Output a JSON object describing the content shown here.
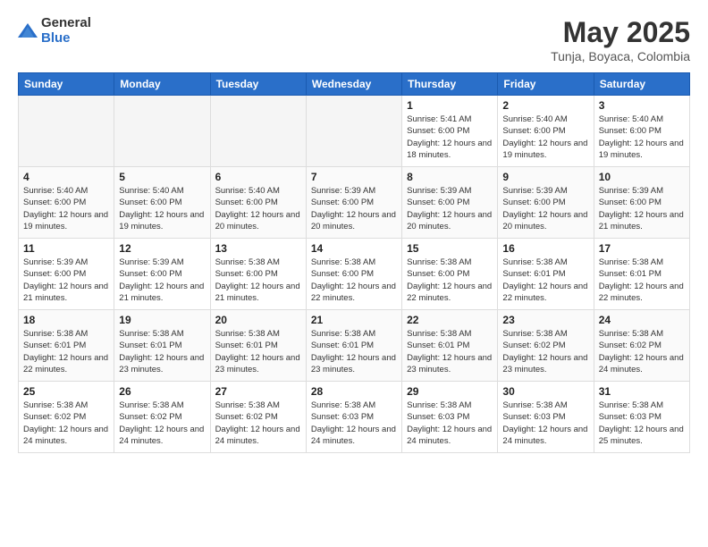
{
  "logo": {
    "general": "General",
    "blue": "Blue"
  },
  "header": {
    "title": "May 2025",
    "subtitle": "Tunja, Boyaca, Colombia"
  },
  "weekdays": [
    "Sunday",
    "Monday",
    "Tuesday",
    "Wednesday",
    "Thursday",
    "Friday",
    "Saturday"
  ],
  "weeks": [
    [
      {
        "day": "",
        "info": ""
      },
      {
        "day": "",
        "info": ""
      },
      {
        "day": "",
        "info": ""
      },
      {
        "day": "",
        "info": ""
      },
      {
        "day": "1",
        "info": "Sunrise: 5:41 AM\nSunset: 6:00 PM\nDaylight: 12 hours\nand 18 minutes."
      },
      {
        "day": "2",
        "info": "Sunrise: 5:40 AM\nSunset: 6:00 PM\nDaylight: 12 hours\nand 19 minutes."
      },
      {
        "day": "3",
        "info": "Sunrise: 5:40 AM\nSunset: 6:00 PM\nDaylight: 12 hours\nand 19 minutes."
      }
    ],
    [
      {
        "day": "4",
        "info": "Sunrise: 5:40 AM\nSunset: 6:00 PM\nDaylight: 12 hours\nand 19 minutes."
      },
      {
        "day": "5",
        "info": "Sunrise: 5:40 AM\nSunset: 6:00 PM\nDaylight: 12 hours\nand 19 minutes."
      },
      {
        "day": "6",
        "info": "Sunrise: 5:40 AM\nSunset: 6:00 PM\nDaylight: 12 hours\nand 20 minutes."
      },
      {
        "day": "7",
        "info": "Sunrise: 5:39 AM\nSunset: 6:00 PM\nDaylight: 12 hours\nand 20 minutes."
      },
      {
        "day": "8",
        "info": "Sunrise: 5:39 AM\nSunset: 6:00 PM\nDaylight: 12 hours\nand 20 minutes."
      },
      {
        "day": "9",
        "info": "Sunrise: 5:39 AM\nSunset: 6:00 PM\nDaylight: 12 hours\nand 20 minutes."
      },
      {
        "day": "10",
        "info": "Sunrise: 5:39 AM\nSunset: 6:00 PM\nDaylight: 12 hours\nand 21 minutes."
      }
    ],
    [
      {
        "day": "11",
        "info": "Sunrise: 5:39 AM\nSunset: 6:00 PM\nDaylight: 12 hours\nand 21 minutes."
      },
      {
        "day": "12",
        "info": "Sunrise: 5:39 AM\nSunset: 6:00 PM\nDaylight: 12 hours\nand 21 minutes."
      },
      {
        "day": "13",
        "info": "Sunrise: 5:38 AM\nSunset: 6:00 PM\nDaylight: 12 hours\nand 21 minutes."
      },
      {
        "day": "14",
        "info": "Sunrise: 5:38 AM\nSunset: 6:00 PM\nDaylight: 12 hours\nand 22 minutes."
      },
      {
        "day": "15",
        "info": "Sunrise: 5:38 AM\nSunset: 6:00 PM\nDaylight: 12 hours\nand 22 minutes."
      },
      {
        "day": "16",
        "info": "Sunrise: 5:38 AM\nSunset: 6:01 PM\nDaylight: 12 hours\nand 22 minutes."
      },
      {
        "day": "17",
        "info": "Sunrise: 5:38 AM\nSunset: 6:01 PM\nDaylight: 12 hours\nand 22 minutes."
      }
    ],
    [
      {
        "day": "18",
        "info": "Sunrise: 5:38 AM\nSunset: 6:01 PM\nDaylight: 12 hours\nand 22 minutes."
      },
      {
        "day": "19",
        "info": "Sunrise: 5:38 AM\nSunset: 6:01 PM\nDaylight: 12 hours\nand 23 minutes."
      },
      {
        "day": "20",
        "info": "Sunrise: 5:38 AM\nSunset: 6:01 PM\nDaylight: 12 hours\nand 23 minutes."
      },
      {
        "day": "21",
        "info": "Sunrise: 5:38 AM\nSunset: 6:01 PM\nDaylight: 12 hours\nand 23 minutes."
      },
      {
        "day": "22",
        "info": "Sunrise: 5:38 AM\nSunset: 6:01 PM\nDaylight: 12 hours\nand 23 minutes."
      },
      {
        "day": "23",
        "info": "Sunrise: 5:38 AM\nSunset: 6:02 PM\nDaylight: 12 hours\nand 23 minutes."
      },
      {
        "day": "24",
        "info": "Sunrise: 5:38 AM\nSunset: 6:02 PM\nDaylight: 12 hours\nand 24 minutes."
      }
    ],
    [
      {
        "day": "25",
        "info": "Sunrise: 5:38 AM\nSunset: 6:02 PM\nDaylight: 12 hours\nand 24 minutes."
      },
      {
        "day": "26",
        "info": "Sunrise: 5:38 AM\nSunset: 6:02 PM\nDaylight: 12 hours\nand 24 minutes."
      },
      {
        "day": "27",
        "info": "Sunrise: 5:38 AM\nSunset: 6:02 PM\nDaylight: 12 hours\nand 24 minutes."
      },
      {
        "day": "28",
        "info": "Sunrise: 5:38 AM\nSunset: 6:03 PM\nDaylight: 12 hours\nand 24 minutes."
      },
      {
        "day": "29",
        "info": "Sunrise: 5:38 AM\nSunset: 6:03 PM\nDaylight: 12 hours\nand 24 minutes."
      },
      {
        "day": "30",
        "info": "Sunrise: 5:38 AM\nSunset: 6:03 PM\nDaylight: 12 hours\nand 24 minutes."
      },
      {
        "day": "31",
        "info": "Sunrise: 5:38 AM\nSunset: 6:03 PM\nDaylight: 12 hours\nand 25 minutes."
      }
    ]
  ]
}
